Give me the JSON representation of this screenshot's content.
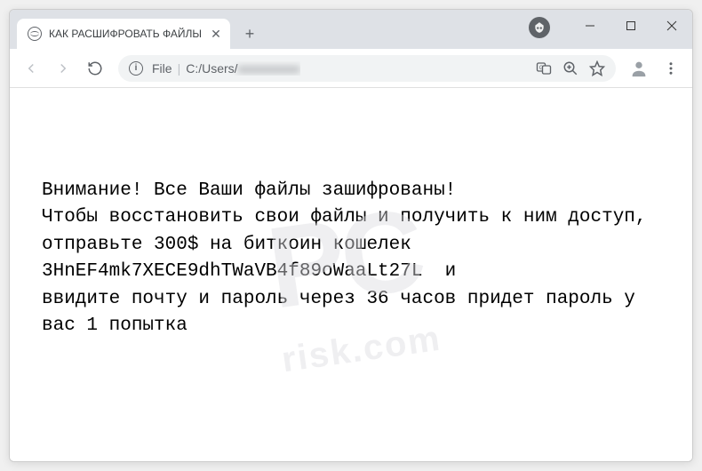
{
  "tab": {
    "title": "КАК РАСШИФРОВАТЬ ФАЙЛЫ"
  },
  "addressbar": {
    "scheme": "File",
    "path_prefix": "C:/Users/",
    "path_blurred": "xxxxxxxxxx"
  },
  "page": {
    "line1": "Внимание! Все Ваши файлы зашифрованы!",
    "line2": "Чтобы восстановить свои файлы и получить к ним доступ,",
    "line3": "отправьте 300$ на биткоин кошелек",
    "line4": "3HnEF4mk7XECE9dhTWaVB4f89oWaaLt27L  и",
    "line5": "ввидите почту и пароль через 36 часов придет пароль у вас 1 попытка"
  },
  "watermark": {
    "main": "PC",
    "sub": "risk.com"
  }
}
